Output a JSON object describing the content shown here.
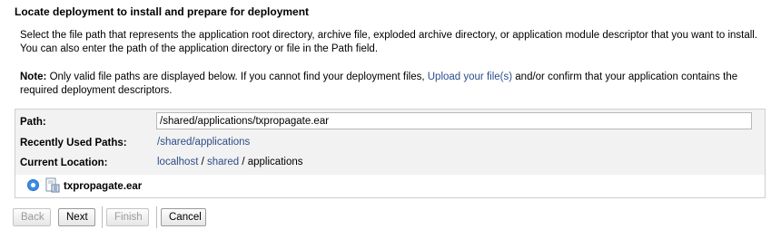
{
  "section": {
    "title": "Locate deployment to install and prepare for deployment",
    "description": "Select the file path that represents the application root directory, archive file, exploded archive directory, or application module descriptor that you want to install. You can also enter the path of the application directory or file in the Path field.",
    "note_label": "Note:",
    "note_text_before": " Only valid file paths are displayed below. If you cannot find your deployment files, ",
    "note_link": "Upload your file(s)",
    "note_text_after": " and/or confirm that your application contains the required deployment descriptors."
  },
  "form": {
    "path_label": "Path:",
    "path_value": "/shared/applications/txpropagate.ear",
    "recent_label": "Recently Used Paths:",
    "recent_link": "/shared/applications",
    "location_label": "Current Location:",
    "location": {
      "host": "localhost",
      "sep1": " / ",
      "dir": "shared",
      "sep2": " / ",
      "current": "applications"
    }
  },
  "files": [
    {
      "name": "txpropagate.ear",
      "selected": true,
      "icon": "archive-file-icon"
    }
  ],
  "buttons": {
    "back": "Back",
    "next": "Next",
    "finish": "Finish",
    "cancel": "Cancel"
  }
}
